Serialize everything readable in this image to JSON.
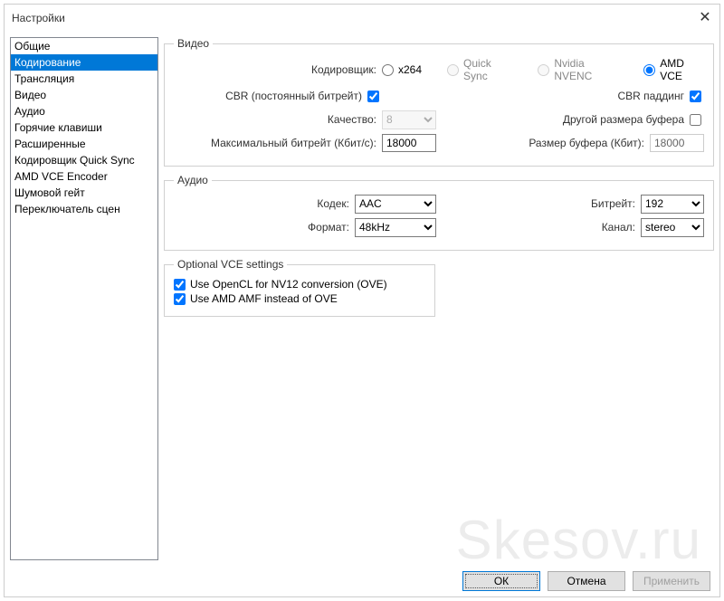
{
  "window": {
    "title": "Настройки"
  },
  "sidebar": {
    "items": [
      "Общие",
      "Кодирование",
      "Трансляция",
      "Видео",
      "Аудио",
      "Горячие клавиши",
      "Расширенные",
      "Кодировщик Quick Sync",
      "AMD VCE Encoder",
      "Шумовой гейт",
      "Переключатель сцен"
    ],
    "selected_index": 1
  },
  "video": {
    "legend": "Видео",
    "encoder_label": "Кодировщик:",
    "encoders": {
      "x264": "x264",
      "quicksync": "Quick Sync",
      "nvenc": "Nvidia NVENC",
      "amdvce": "AMD VCE",
      "selected": "amdvce"
    },
    "cbr_label": "CBR (постоянный битрейт)",
    "cbr_checked": true,
    "cbr_padding_label": "CBR паддинг",
    "cbr_padding_checked": true,
    "quality_label": "Качество:",
    "quality_value": "8",
    "custom_buffer_label": "Другой размера буфера",
    "custom_buffer_checked": false,
    "max_bitrate_label": "Максимальный битрейт (Кбит/с):",
    "max_bitrate_value": "18000",
    "buffer_size_label": "Размер буфера (Кбит):",
    "buffer_size_value": "18000"
  },
  "audio": {
    "legend": "Аудио",
    "codec_label": "Кодек:",
    "codec_value": "AAC",
    "bitrate_label": "Битрейт:",
    "bitrate_value": "192",
    "format_label": "Формат:",
    "format_value": "48kHz",
    "channel_label": "Канал:",
    "channel_value": "stereo"
  },
  "vce": {
    "legend": "Optional VCE settings",
    "opencl_label": "Use OpenCL for NV12 conversion (OVE)",
    "opencl_checked": true,
    "amf_label": "Use AMD AMF instead of OVE",
    "amf_checked": true
  },
  "buttons": {
    "ok": "ОК",
    "cancel": "Отмена",
    "apply": "Применить"
  },
  "watermark": "Skesov.ru"
}
